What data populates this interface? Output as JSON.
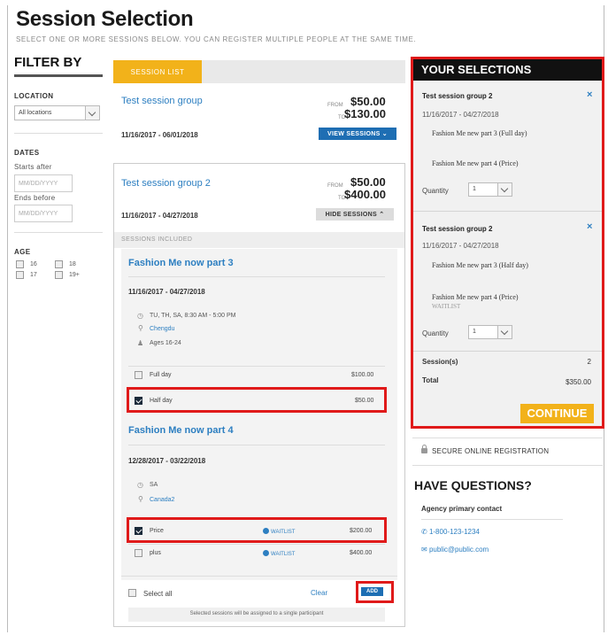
{
  "page": {
    "title": "Session Selection",
    "subtitle": "SELECT ONE OR MORE SESSIONS BELOW. YOU CAN REGISTER MULTIPLE PEOPLE AT THE SAME TIME."
  },
  "filter": {
    "heading": "FILTER BY",
    "location_label": "LOCATION",
    "location_value": "All locations",
    "dates_label": "DATES",
    "starts_after_label": "Starts after",
    "starts_after_placeholder": "MM/DD/YYYY",
    "ends_before_label": "Ends before",
    "ends_before_placeholder": "MM/DD/YYYY",
    "age_label": "AGE",
    "ages": [
      "16",
      "18",
      "17",
      "19+"
    ]
  },
  "session_list": {
    "tab_label": "SESSION LIST",
    "group1": {
      "title": "Test session group",
      "from_label": "FROM",
      "from_price": "$50.00",
      "to_label": "TO",
      "to_price": "$130.00",
      "dates": "11/16/2017 - 06/01/2018",
      "button": "VIEW SESSIONS"
    },
    "group2": {
      "title": "Test session group 2",
      "from_label": "FROM",
      "from_price": "$50.00",
      "to_label": "TO",
      "to_price": "$400.00",
      "dates": "11/16/2017 - 04/27/2018",
      "button": "HIDE SESSIONS",
      "included_label": "SESSIONS INCLUDED"
    },
    "session1": {
      "title": "Fashion Me now part 3",
      "dates": "11/16/2017 - 04/27/2018",
      "schedule": "TU, TH, SA, 8:30 AM - 5:00 PM",
      "location": "Chengdu",
      "ages": "Ages 16-24",
      "options": [
        {
          "label": "Full day",
          "price": "$100.00",
          "checked": false
        },
        {
          "label": "Half day",
          "price": "$50.00",
          "checked": true
        }
      ]
    },
    "session2": {
      "title": "Fashion Me now part 4",
      "dates": "12/28/2017 - 03/22/2018",
      "schedule": "SA",
      "location": "Canada2",
      "options": [
        {
          "label": "Price",
          "waitlist": "WAITLIST",
          "price": "$200.00",
          "checked": true
        },
        {
          "label": "plus",
          "waitlist": "WAITLIST",
          "price": "$400.00",
          "checked": false
        }
      ]
    },
    "select_all": "Select all",
    "clear": "Clear",
    "add": "ADD",
    "note": "Selected sessions will be assigned to a single participant"
  },
  "selections": {
    "heading": "YOUR SELECTIONS",
    "items": [
      {
        "title": "Test session group 2",
        "dates": "11/16/2017 - 04/27/2018",
        "lines": [
          "Fashion Me new part 3 (Full day)",
          "Fashion Me new part 4 (Price)"
        ],
        "quantity_label": "Quantity",
        "quantity": "1"
      },
      {
        "title": "Test session group 2",
        "dates": "11/16/2017 - 04/27/2018",
        "lines": [
          "Fashion Me new part 3 (Half day)",
          "Fashion Me new part 4 (Price)"
        ],
        "waitlist": "WAITLIST",
        "quantity_label": "Quantity",
        "quantity": "1"
      }
    ],
    "sessions_label": "Session(s)",
    "sessions_count": "2",
    "total_label": "Total",
    "total_value": "$350.00",
    "continue": "CONTINUE"
  },
  "sidebar": {
    "secure": "SECURE ONLINE REGISTRATION",
    "questions_heading": "HAVE QUESTIONS?",
    "contact_title": "Agency primary contact",
    "phone": "1-800-123-1234",
    "email": "public@public.com"
  },
  "colors": {
    "accent_orange": "#f2b21a",
    "link_blue": "#2d7fc1",
    "button_blue": "#1e6eb3",
    "highlight_red": "#e01a1a"
  }
}
